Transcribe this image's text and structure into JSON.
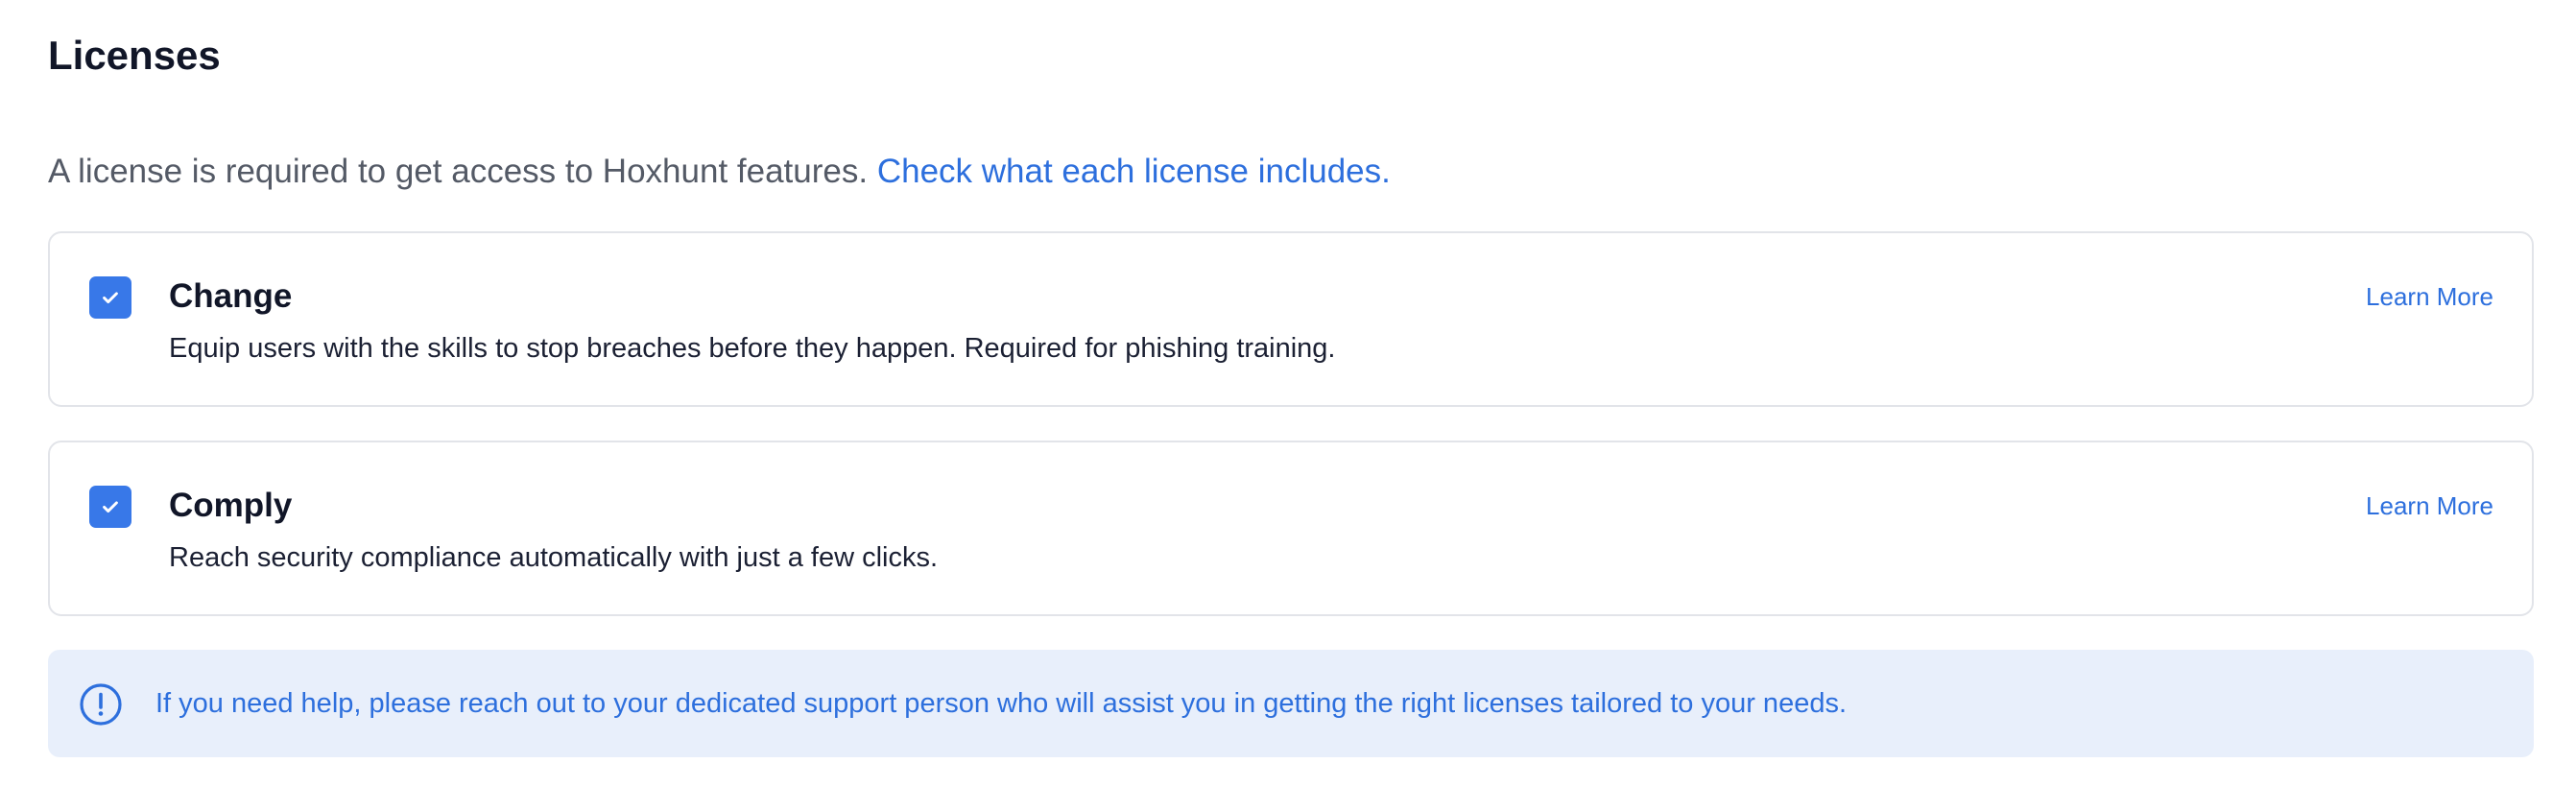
{
  "page": {
    "title": "Licenses",
    "intro_text": "A license is required to get access to Hoxhunt features.",
    "intro_link": "Check what each license includes."
  },
  "licenses": [
    {
      "name": "Change",
      "description": "Equip users with the skills to stop breaches before they happen. Required for phishing training.",
      "checked": true,
      "learn_more_label": "Learn More"
    },
    {
      "name": "Comply",
      "description": "Reach security compliance automatically with just a few clicks.",
      "checked": true,
      "learn_more_label": "Learn More"
    }
  ],
  "help": {
    "icon": "info-circle-icon",
    "text": "If you need help, please reach out to your dedicated support person who will assist you in getting the right licenses tailored to your needs."
  },
  "colors": {
    "accent": "#3878e8",
    "link": "#2d6fdd",
    "help_background": "#e8effb"
  }
}
